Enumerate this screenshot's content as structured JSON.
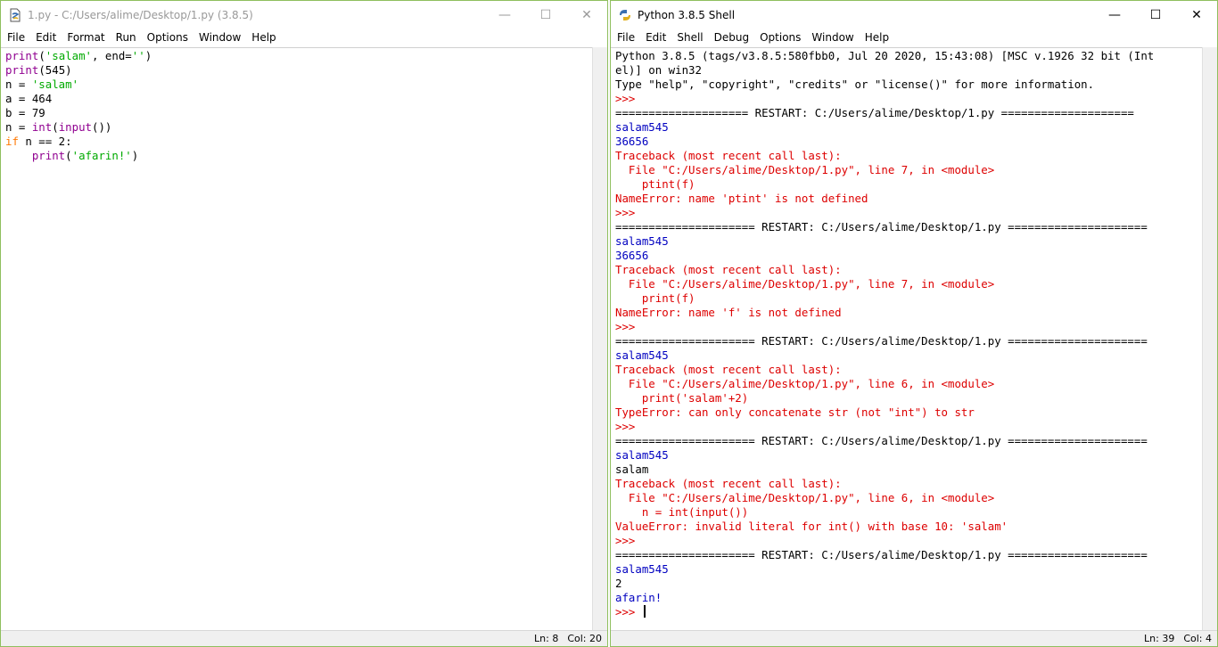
{
  "editor": {
    "title": "1.py - C:/Users/alime/Desktop/1.py (3.8.5)",
    "menu": [
      "File",
      "Edit",
      "Format",
      "Run",
      "Options",
      "Window",
      "Help"
    ],
    "code": [
      [
        {
          "t": "print",
          "c": "bi"
        },
        {
          "t": "(",
          "c": ""
        },
        {
          "t": "'salam'",
          "c": "str"
        },
        {
          "t": ", end=",
          "c": ""
        },
        {
          "t": "''",
          "c": "str"
        },
        {
          "t": ")",
          "c": ""
        }
      ],
      [
        {
          "t": "print",
          "c": "bi"
        },
        {
          "t": "(545)",
          "c": ""
        }
      ],
      [
        {
          "t": "n = ",
          "c": ""
        },
        {
          "t": "'salam'",
          "c": "str"
        }
      ],
      [
        {
          "t": "a = 464",
          "c": ""
        }
      ],
      [
        {
          "t": "b = 79",
          "c": ""
        }
      ],
      [
        {
          "t": "n = ",
          "c": ""
        },
        {
          "t": "int",
          "c": "bi"
        },
        {
          "t": "(",
          "c": ""
        },
        {
          "t": "input",
          "c": "bi"
        },
        {
          "t": "())",
          "c": ""
        }
      ],
      [
        {
          "t": "if",
          "c": "kw"
        },
        {
          "t": " n == 2:",
          "c": ""
        }
      ],
      [
        {
          "t": "    ",
          "c": ""
        },
        {
          "t": "print",
          "c": "bi"
        },
        {
          "t": "(",
          "c": ""
        },
        {
          "t": "'afarin!'",
          "c": "str"
        },
        {
          "t": ")",
          "c": ""
        }
      ]
    ],
    "status": {
      "ln": "Ln: 8",
      "col": "Col: 20"
    }
  },
  "shell": {
    "title": "Python 3.8.5 Shell",
    "menu": [
      "File",
      "Edit",
      "Shell",
      "Debug",
      "Options",
      "Window",
      "Help"
    ],
    "lines": [
      {
        "t": "Python 3.8.5 (tags/v3.8.5:580fbb0, Jul 20 2020, 15:43:08) [MSC v.1926 32 bit (Int",
        "c": ""
      },
      {
        "t": "el)] on win32",
        "c": ""
      },
      {
        "t": "Type \"help\", \"copyright\", \"credits\" or \"license()\" for more information.",
        "c": ""
      },
      {
        "t": ">>> ",
        "c": "err"
      },
      {
        "t": "==================== RESTART: C:/Users/alime/Desktop/1.py ====================",
        "c": ""
      },
      {
        "t": "salam545",
        "c": "out"
      },
      {
        "t": "36656",
        "c": "out"
      },
      {
        "t": "Traceback (most recent call last):",
        "c": "err"
      },
      {
        "t": "  File \"C:/Users/alime/Desktop/1.py\", line 7, in <module>",
        "c": "err"
      },
      {
        "t": "    ptint(f)",
        "c": "err"
      },
      {
        "t": "NameError: name 'ptint' is not defined",
        "c": "err"
      },
      {
        "t": ">>> ",
        "c": "err"
      },
      {
        "t": "===================== RESTART: C:/Users/alime/Desktop/1.py =====================",
        "c": ""
      },
      {
        "t": "salam545",
        "c": "out"
      },
      {
        "t": "36656",
        "c": "out"
      },
      {
        "t": "Traceback (most recent call last):",
        "c": "err"
      },
      {
        "t": "  File \"C:/Users/alime/Desktop/1.py\", line 7, in <module>",
        "c": "err"
      },
      {
        "t": "    print(f)",
        "c": "err"
      },
      {
        "t": "NameError: name 'f' is not defined",
        "c": "err"
      },
      {
        "t": ">>> ",
        "c": "err"
      },
      {
        "t": "===================== RESTART: C:/Users/alime/Desktop/1.py =====================",
        "c": ""
      },
      {
        "t": "salam545",
        "c": "out"
      },
      {
        "t": "Traceback (most recent call last):",
        "c": "err"
      },
      {
        "t": "  File \"C:/Users/alime/Desktop/1.py\", line 6, in <module>",
        "c": "err"
      },
      {
        "t": "    print('salam'+2)",
        "c": "err"
      },
      {
        "t": "TypeError: can only concatenate str (not \"int\") to str",
        "c": "err"
      },
      {
        "t": ">>> ",
        "c": "err"
      },
      {
        "t": "===================== RESTART: C:/Users/alime/Desktop/1.py =====================",
        "c": ""
      },
      {
        "t": "salam545",
        "c": "out"
      },
      {
        "t": "salam",
        "c": ""
      },
      {
        "t": "Traceback (most recent call last):",
        "c": "err"
      },
      {
        "t": "  File \"C:/Users/alime/Desktop/1.py\", line 6, in <module>",
        "c": "err"
      },
      {
        "t": "    n = int(input())",
        "c": "err"
      },
      {
        "t": "ValueError: invalid literal for int() with base 10: 'salam'",
        "c": "err"
      },
      {
        "t": ">>> ",
        "c": "err"
      },
      {
        "t": "===================== RESTART: C:/Users/alime/Desktop/1.py =====================",
        "c": ""
      },
      {
        "t": "salam545",
        "c": "out"
      },
      {
        "t": "2",
        "c": ""
      },
      {
        "t": "afarin!",
        "c": "out"
      }
    ],
    "prompt": ">>> ",
    "status": {
      "ln": "Ln: 39",
      "col": "Col: 4"
    }
  },
  "window_controls": {
    "minimize": "—",
    "maximize": "☐",
    "close": "✕"
  }
}
